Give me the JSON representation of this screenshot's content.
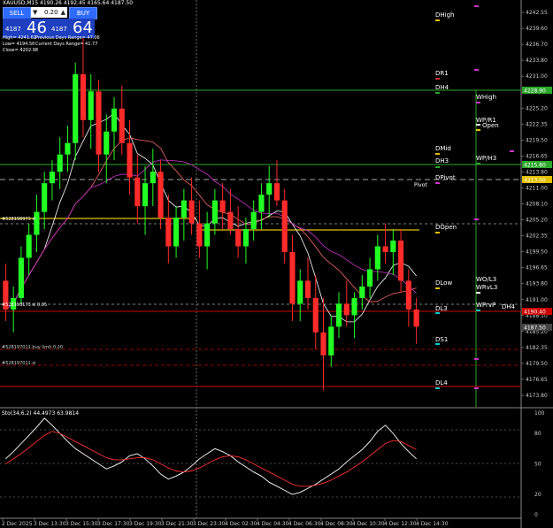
{
  "symbol_header": "XAUUSD,M15  4190.26 4192.45 4165.64 4187.50",
  "trade_panel": {
    "sell_label": "SELL",
    "buy_label": "BUY",
    "lot": "0.20",
    "lot_minus": "▼",
    "lot_plus": "▲",
    "sell_price_small": "4187",
    "sell_price_big": "46",
    "buy_price_small": "4187",
    "buy_price_big": "64"
  },
  "daily_stats": {
    "high": "High= 4241.62",
    "low": "Low= 4194.56",
    "close": "Close= 4202.98",
    "prev_range": "Previous Days Range= 47.06",
    "curr_range": "Current Days Range= 41.77"
  },
  "price_axis": [
    "4242.55",
    "4239.60",
    "4236.70",
    "4233.80",
    "4231.00",
    "4228.10",
    "4225.20",
    "4222.35",
    "4219.50",
    "4216.65",
    "4213.80",
    "4211.00",
    "4208.10",
    "4205.20",
    "4202.35",
    "4199.50",
    "4196.65",
    "4193.80",
    "4191.00",
    "4188.10",
    "4185.20",
    "4182.35",
    "4179.50",
    "4176.65",
    "4173.80"
  ],
  "price_tags": [
    {
      "text": "4228.90",
      "color": "#2ca82c"
    },
    {
      "text": "4215.80",
      "color": "#2ca82c"
    },
    {
      "text": "4213.00",
      "color": "#e3c000"
    },
    {
      "text": "4190.40",
      "color": "#cc0000"
    },
    {
      "text": "4187.50",
      "color": "#444444"
    }
  ],
  "levels": {
    "DHigh": "DHigh",
    "DR1": "DR1",
    "DH4": "DH4",
    "WHigh": "WHigh",
    "WP_R1": "WP/R1",
    "Open": "Open",
    "DMid": "DMid",
    "DH3": "DH3",
    "WP_H3": "WP/H3",
    "DPivot": "DPivot",
    "Pivot": "Pivot",
    "DOpen": "DOpen",
    "DLow": "DLow",
    "WO_L3": "WO/L3",
    "WRvL3": "WRvL3",
    "DL3": "DL3",
    "WPrvP": "WPrvP",
    "DH4b": "DH4",
    "DS1": "DS1",
    "DL4": "DL4"
  },
  "order_labels": {
    "o1": "#528198973 sl",
    "o2": "#528198173 sl 0.05",
    "o3": "#528197011 buy limit 0.20",
    "o4": "#528197011 sl"
  },
  "stoch": {
    "label": "Sto(34,6,2) 44.4973 63.9814",
    "axis": [
      "100",
      "80",
      "50",
      "20",
      "0"
    ]
  },
  "time_axis": [
    "2 Dec 2025",
    "3 Dec 13:30",
    "3 Dec 15:30",
    "3 Dec 17:30",
    "3 Dec 19:30",
    "3 Dec 21:30",
    "3 Dec 23:30",
    "4 Dec 02:30",
    "4 Dec 04:30",
    "4 Dec 06:30",
    "4 Dec 08:30",
    "4 Dec 10:30",
    "4 Dec 12:30",
    "4 Dec 14:30"
  ],
  "colors": {
    "bull": "#22ff22",
    "bear": "#ff2a2a",
    "ma_white": "#ffffff",
    "ma_red": "#ff6b6b",
    "ma_magenta": "#cc33cc",
    "green_line": "#2ca82c",
    "yellow_line": "#e3c000",
    "red_line": "#cc0000"
  },
  "chart_data": {
    "type": "candlestick",
    "ylim": [
      4173.8,
      4243.0
    ],
    "candles": [
      [
        4195,
        4198,
        4188,
        4190
      ],
      [
        4190,
        4194,
        4186,
        4192
      ],
      [
        4192,
        4201,
        4191,
        4199
      ],
      [
        4199,
        4205,
        4196,
        4203
      ],
      [
        4203,
        4210,
        4200,
        4207
      ],
      [
        4207,
        4214,
        4204,
        4212
      ],
      [
        4212,
        4216,
        4209,
        4214
      ],
      [
        4214,
        4220,
        4211,
        4217
      ],
      [
        4217,
        4222,
        4214,
        4219
      ],
      [
        4219,
        4233,
        4216,
        4231
      ],
      [
        4231,
        4238,
        4220,
        4223
      ],
      [
        4223,
        4231,
        4218,
        4228
      ],
      [
        4228,
        4230,
        4214,
        4217
      ],
      [
        4217,
        4224,
        4212,
        4221
      ],
      [
        4221,
        4227,
        4216,
        4225
      ],
      [
        4225,
        4229,
        4217,
        4219
      ],
      [
        4219,
        4223,
        4210,
        4213
      ],
      [
        4213,
        4217,
        4205,
        4208
      ],
      [
        4208,
        4215,
        4203,
        4212
      ],
      [
        4212,
        4218,
        4208,
        4214
      ],
      [
        4214,
        4216,
        4204,
        4206
      ],
      [
        4206,
        4210,
        4198,
        4201
      ],
      [
        4201,
        4208,
        4199,
        4206
      ],
      [
        4206,
        4211,
        4202,
        4209
      ],
      [
        4209,
        4213,
        4203,
        4205
      ],
      [
        4205,
        4209,
        4199,
        4201
      ],
      [
        4201,
        4207,
        4197,
        4205
      ],
      [
        4205,
        4211,
        4203,
        4209
      ],
      [
        4209,
        4212,
        4204,
        4207
      ],
      [
        4207,
        4211,
        4203,
        4204
      ],
      [
        4204,
        4208,
        4199,
        4201
      ],
      [
        4201,
        4206,
        4198,
        4204
      ],
      [
        4204,
        4209,
        4202,
        4207
      ],
      [
        4207,
        4212,
        4204,
        4210
      ],
      [
        4210,
        4215,
        4206,
        4212
      ],
      [
        4212,
        4216,
        4208,
        4209
      ],
      [
        4209,
        4211,
        4198,
        4200
      ],
      [
        4200,
        4203,
        4188,
        4191
      ],
      [
        4191,
        4197,
        4188,
        4195
      ],
      [
        4195,
        4199,
        4190,
        4192
      ],
      [
        4192,
        4196,
        4183,
        4186
      ],
      [
        4186,
        4192,
        4176,
        4182
      ],
      [
        4182,
        4189,
        4180,
        4187
      ],
      [
        4187,
        4193,
        4185,
        4191
      ],
      [
        4191,
        4195,
        4187,
        4189
      ],
      [
        4189,
        4193,
        4185,
        4192
      ],
      [
        4192,
        4196,
        4190,
        4194
      ],
      [
        4194,
        4199,
        4192,
        4197
      ],
      [
        4197,
        4203,
        4195,
        4201
      ],
      [
        4201,
        4205,
        4198,
        4200
      ],
      [
        4200,
        4204,
        4196,
        4202
      ],
      [
        4202,
        4204,
        4193,
        4195
      ],
      [
        4195,
        4197,
        4187,
        4190
      ],
      [
        4190,
        4192,
        4184,
        4187
      ]
    ],
    "stoch_main": [
      55,
      62,
      70,
      78,
      86,
      95,
      88,
      80,
      72,
      65,
      60,
      55,
      50,
      45,
      48,
      52,
      58,
      60,
      55,
      48,
      40,
      35,
      38,
      42,
      48,
      55,
      60,
      65,
      62,
      58,
      52,
      47,
      42,
      38,
      32,
      28,
      24,
      20,
      22,
      26,
      30,
      35,
      40,
      45,
      52,
      58,
      64,
      72,
      82,
      88,
      80,
      70,
      62,
      55
    ],
    "stoch_signal": [
      50,
      55,
      60,
      66,
      72,
      78,
      82,
      80,
      76,
      72,
      68,
      64,
      60,
      56,
      54,
      54,
      55,
      56,
      56,
      54,
      50,
      46,
      43,
      42,
      43,
      46,
      50,
      54,
      57,
      58,
      57,
      54,
      50,
      46,
      42,
      38,
      34,
      30,
      28,
      28,
      29,
      31,
      34,
      38,
      42,
      47,
      52,
      58,
      64,
      70,
      73,
      72,
      68,
      64
    ]
  }
}
